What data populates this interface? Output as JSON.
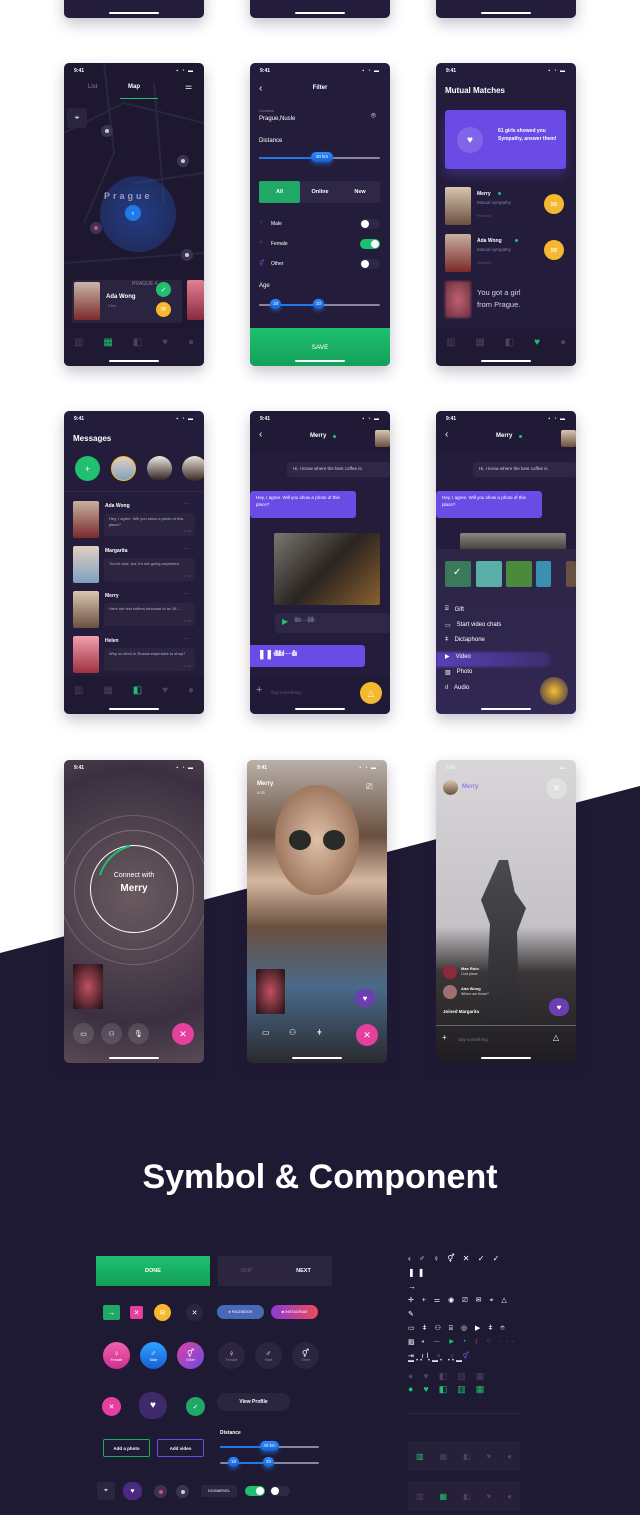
{
  "status_time": "9:41",
  "map_screen": {
    "tabs": [
      "List",
      "Map"
    ],
    "active_tab": "Map",
    "city": "Prague",
    "district": "PRAGUE 4",
    "card_name": "Ada Wong",
    "card_distance": "3 km"
  },
  "filter_screen": {
    "title": "Filter",
    "location_label": "Location",
    "location_value": "Prague,Nusle",
    "distance_label": "Distance",
    "distance_value": "40 km",
    "segments": [
      "All",
      "Online",
      "New"
    ],
    "active_segment": "All",
    "genders": [
      {
        "label": "Male",
        "on": false
      },
      {
        "label": "Female",
        "on": true
      },
      {
        "label": "Other",
        "on": false
      }
    ],
    "age_label": "Age",
    "age_min": "18",
    "age_max": "33",
    "save": "SAVE"
  },
  "matches_screen": {
    "title": "Mutual Matches",
    "banner": "61 girls showed you Sympathy, answer them!",
    "items": [
      {
        "name": "Merry",
        "sub": "Mutual sympathy",
        "time": "Presently"
      },
      {
        "name": "Ada Wong",
        "sub": "Mutual sympathy",
        "time": "Presently"
      }
    ],
    "promo": "You got a girl from Prague."
  },
  "messages_screen": {
    "title": "Messages",
    "items": [
      {
        "name": "Ada Wong",
        "text": "Hey, I agree. Will you show a photo of this place?",
        "time": "17:14"
      },
      {
        "name": "Margarita",
        "text": "You're cute, but I'm not going anywhere.",
        "time": "17:14"
      },
      {
        "name": "Merry",
        "text": "Here the text suffers because of av 28 ...",
        "time": "17:14"
      },
      {
        "name": "Helen",
        "text": "Why so birch in Russia expensive to shop?",
        "time": "17:14"
      }
    ]
  },
  "chat_screen": {
    "name": "Merry",
    "msg_in": "Hi, I know where the best coffee is.",
    "msg_out": "Hey, I agree. Will you show a photo of this place?",
    "placeholder": "Say something..."
  },
  "attach_menu": {
    "items": [
      "Gift",
      "Start video chats",
      "Dictaphone",
      "Video",
      "Photo",
      "Audio"
    ],
    "highlighted": "Video"
  },
  "call_screen": {
    "connect": "Connect with",
    "name": "Merry"
  },
  "video_screen": {
    "name": "Merry",
    "duration": "0:25"
  },
  "stream_screen": {
    "name": "Merry",
    "comments": [
      {
        "name": "Max Rolo",
        "text": "Cool place"
      },
      {
        "name": "Ada Wong",
        "text": "Where are those?"
      }
    ],
    "joined": "Joined Margarita",
    "placeholder": "Say something"
  },
  "components": {
    "title": "Symbol & Component",
    "done": "DONE",
    "skip": "SKIP",
    "next": "NEXT",
    "facebook": "FACEBOOK",
    "instagram": "INSTAGRAM",
    "genders": [
      "Female",
      "Male",
      "Other"
    ],
    "view_profile": "View Profile",
    "add_photo": "Add a photo",
    "add_video": "Add video",
    "distance_label": "Distance",
    "distance_value": "40 km",
    "age_min": "18",
    "age_max": "33",
    "tag": "DC/MARVEL"
  },
  "colors": {
    "background_dark": "#1f1a33",
    "phone_bg": "#231c3a",
    "green": "#1fc06f",
    "purple": "#6b4be6",
    "yellow": "#f5b82e",
    "pink": "#e6409f",
    "blue": "#1f7ae8"
  }
}
